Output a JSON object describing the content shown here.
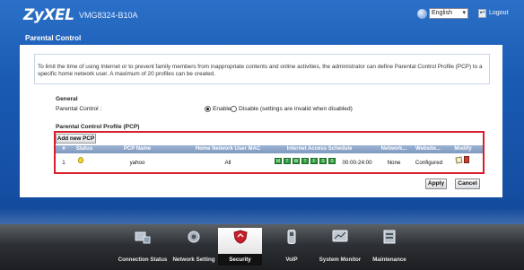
{
  "header": {
    "logo": "ZyXEL",
    "model": "VMG8324-B10A",
    "language": "English",
    "logout": "Logout"
  },
  "page": {
    "title": "Parental Control",
    "intro": "To limit the time of using Internet or to prevent family members from inappropriate contents and online activities, the administrator can define Parental Control Profile (PCP) to a specific home network user. A maximum of 20 profiles can be created."
  },
  "general": {
    "heading": "General",
    "label": "Parental Control :",
    "enable_label": "Enable",
    "disable_label": "Disable (settings are invalid when disabled)",
    "enabled": true
  },
  "pcp": {
    "heading": "Parental Control Profile (PCP)",
    "add_button": "Add new PCP",
    "columns": [
      "#",
      "Status",
      "PCP Name",
      "Home Network User MAC",
      "Internet Access Schedule",
      "Network...",
      "Website...",
      "Modify"
    ],
    "rows": [
      {
        "index": "1",
        "pcp_name": "yahoo",
        "mac": "All",
        "days": [
          "M",
          "T",
          "W",
          "T",
          "F",
          "S",
          "S"
        ],
        "time": "00:00-24:00",
        "network": "None",
        "website": "Configured"
      }
    ]
  },
  "actions": {
    "apply": "Apply",
    "cancel": "Cancel"
  },
  "dock": {
    "items": [
      {
        "label": "Connection Status",
        "icon": "connection-status-icon"
      },
      {
        "label": "Network Setting",
        "icon": "network-setting-icon"
      },
      {
        "label": "Security",
        "icon": "security-icon"
      },
      {
        "label": "VoIP",
        "icon": "voip-icon"
      },
      {
        "label": "System Monitor",
        "icon": "system-monitor-icon"
      },
      {
        "label": "Maintenance",
        "icon": "maintenance-icon"
      }
    ],
    "active_index": 2
  },
  "colors": {
    "highlight_border": "#d81e2c",
    "schedule_day": "#2f9b3d",
    "header_bg": "#1a5ab3"
  }
}
